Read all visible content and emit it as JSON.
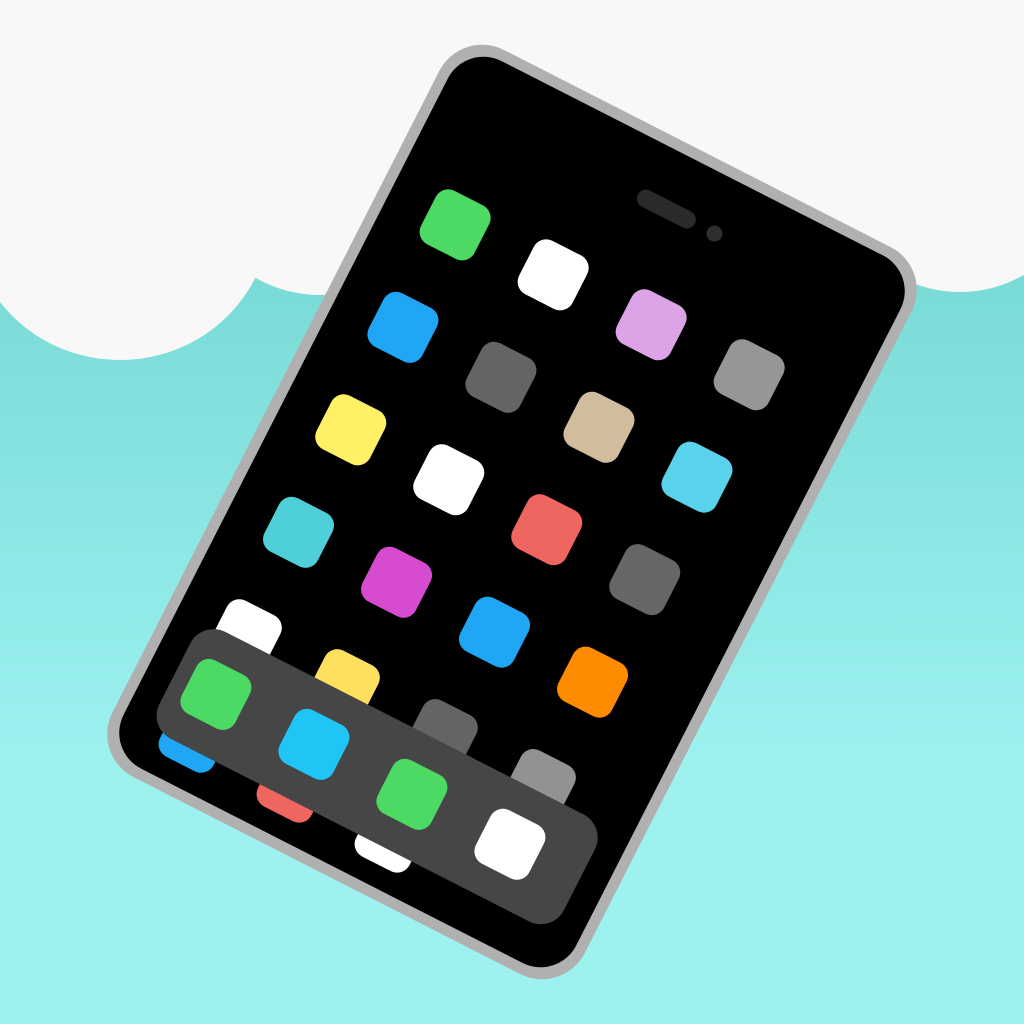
{
  "colors": {
    "sky_top": "#66cdc8",
    "sky_bottom": "#9df2f0",
    "cloud": "#f8f8f8",
    "phone_frame": "#b0b0b0",
    "screen": "#000000",
    "earpiece": "#2a2a2a",
    "camera": "#2e2e2e",
    "dock": "#464646"
  },
  "home_screen": {
    "rows": [
      {
        "apps": [
          {
            "icon": "app-icon-green",
            "color": "#4cd964"
          },
          {
            "icon": "app-icon-white",
            "color": "#ffffff"
          },
          {
            "icon": "app-icon-lavender",
            "color": "#dca3e6"
          },
          {
            "icon": "app-icon-gray",
            "color": "#969696"
          }
        ]
      },
      {
        "apps": [
          {
            "icon": "app-icon-blue",
            "color": "#1fa7f5"
          },
          {
            "icon": "app-icon-dark-gray",
            "color": "#646464"
          },
          {
            "icon": "app-icon-tan",
            "color": "#d1bd9e"
          },
          {
            "icon": "app-icon-light-blue",
            "color": "#5ad2ec"
          }
        ]
      },
      {
        "apps": [
          {
            "icon": "app-icon-yellow",
            "color": "#fff066"
          },
          {
            "icon": "app-icon-white",
            "color": "#ffffff"
          },
          {
            "icon": "app-icon-red",
            "color": "#ef6560"
          },
          {
            "icon": "app-icon-dark-gray",
            "color": "#666666"
          }
        ]
      },
      {
        "apps": [
          {
            "icon": "app-icon-teal",
            "color": "#4fcfd8"
          },
          {
            "icon": "app-icon-magenta",
            "color": "#d64bcf"
          },
          {
            "icon": "app-icon-blue",
            "color": "#1fa7f5"
          },
          {
            "icon": "app-icon-orange",
            "color": "#ff8c00"
          }
        ]
      },
      {
        "apps": [
          {
            "icon": "app-icon-white",
            "color": "#ffffff"
          },
          {
            "icon": "app-icon-yellow",
            "color": "#ffdf5e"
          },
          {
            "icon": "app-icon-dark-gray",
            "color": "#646464"
          },
          {
            "icon": "app-icon-gray",
            "color": "#929292"
          }
        ]
      },
      {
        "apps": [
          {
            "icon": "app-icon-blue",
            "color": "#1fa7f5"
          },
          {
            "icon": "app-icon-red",
            "color": "#ef6560"
          },
          {
            "icon": "app-icon-white",
            "color": "#ffffff"
          }
        ]
      }
    ]
  },
  "dock": {
    "apps": [
      {
        "icon": "dock-icon-green",
        "color": "#4cd964"
      },
      {
        "icon": "dock-icon-sky-blue",
        "color": "#1fc5f5"
      },
      {
        "icon": "dock-icon-green",
        "color": "#4cd964"
      },
      {
        "icon": "dock-icon-white",
        "color": "#ffffff"
      }
    ]
  }
}
